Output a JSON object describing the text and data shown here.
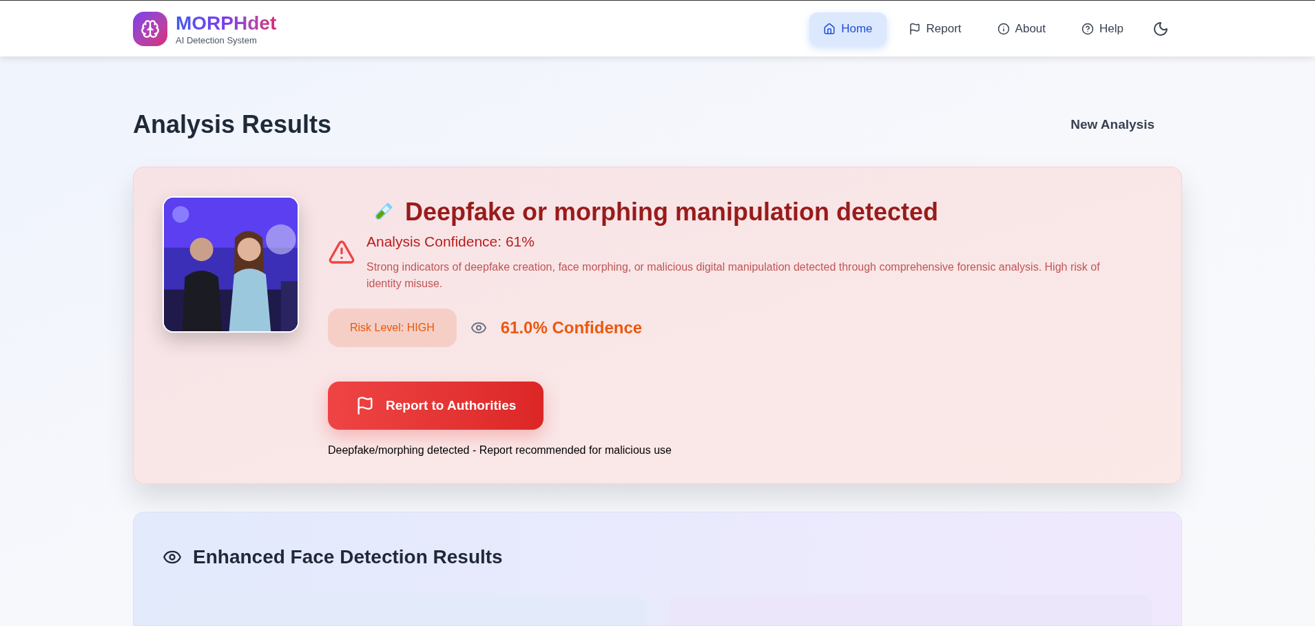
{
  "brand": {
    "name": "MORPHdet",
    "tagline": "AI Detection System"
  },
  "nav": [
    {
      "label": "Home",
      "kind": "home",
      "selected": true
    },
    {
      "label": "Report",
      "kind": "flag",
      "selected": false
    },
    {
      "label": "About",
      "kind": "info",
      "selected": false
    },
    {
      "label": "Help",
      "kind": "help",
      "selected": false
    }
  ],
  "theme": {
    "dark": false
  },
  "page": {
    "title": "Analysis Results",
    "action": "New Analysis"
  },
  "result": {
    "verdict": "Deepfake or morphing manipulation detected",
    "confidence_label": "Analysis Confidence: 61%",
    "description": "Strong indicators of deepfake creation, face morphing, or malicious digital manipulation detected through comprehensive forensic analysis. High risk of identity misuse.",
    "risk": {
      "text": "Risk Level: HIGH",
      "kind": "high"
    },
    "confidence": "61.0% Confidence",
    "report_button": "Report to Authorities",
    "note": "Deepfake/morphing detected - Report recommended for malicious use"
  },
  "faces": {
    "title": "Enhanced Face Detection Results",
    "panels": [
      {
        "kind": "blue"
      },
      {
        "kind": "purple"
      }
    ]
  }
}
